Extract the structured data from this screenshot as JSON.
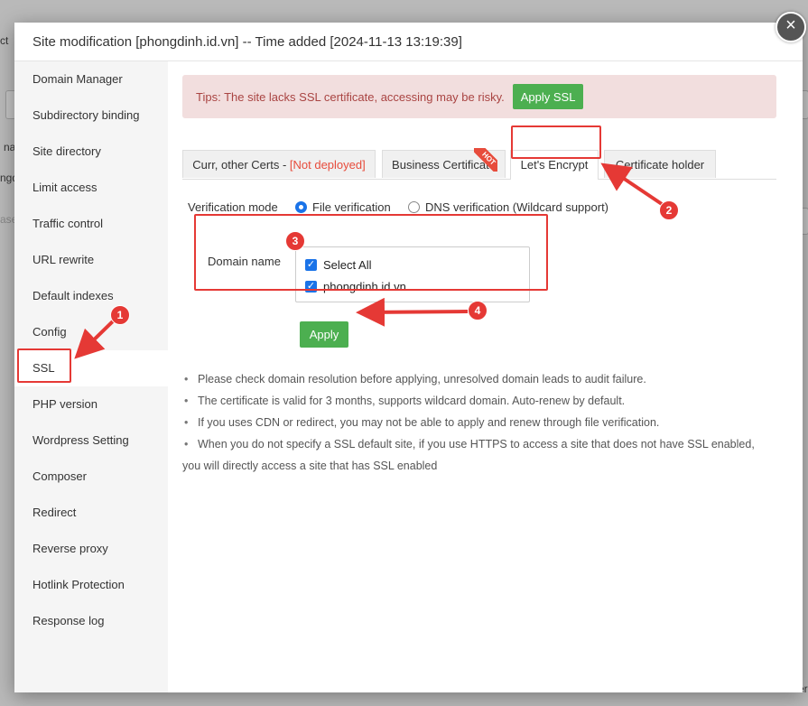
{
  "background": {
    "fragments": [
      "ct",
      "na",
      "ngd",
      "ase",
      "mer"
    ]
  },
  "modal": {
    "title": "Site modification [phongdinh.id.vn] -- Time added [2024-11-13 13:19:39]",
    "close_symbol": "×"
  },
  "sidebar": {
    "items": [
      {
        "label": "Domain Manager"
      },
      {
        "label": "Subdirectory binding"
      },
      {
        "label": "Site directory"
      },
      {
        "label": "Limit access"
      },
      {
        "label": "Traffic control"
      },
      {
        "label": "URL rewrite"
      },
      {
        "label": "Default indexes"
      },
      {
        "label": "Config"
      },
      {
        "label": "SSL"
      },
      {
        "label": "PHP version"
      },
      {
        "label": "Wordpress Setting"
      },
      {
        "label": "Composer"
      },
      {
        "label": "Redirect"
      },
      {
        "label": "Reverse proxy"
      },
      {
        "label": "Hotlink Protection"
      },
      {
        "label": "Response log"
      }
    ],
    "active": "SSL"
  },
  "tips": {
    "text": "Tips: The site lacks SSL certificate, accessing may be risky.",
    "button": "Apply SSL"
  },
  "tabs": {
    "curr_label": "Curr, other Certs - ",
    "curr_status": "[Not deployed]",
    "business": "Business Certificate",
    "hot_badge": "HOT",
    "letsencrypt": "Let's Encrypt",
    "holder": "Certificate holder",
    "active": "Let's Encrypt"
  },
  "verification": {
    "label": "Verification mode",
    "options": [
      "File verification",
      "DNS verification (Wildcard support)"
    ],
    "selected": "File verification"
  },
  "domain": {
    "label": "Domain name",
    "select_all": "Select All",
    "domains": [
      "phongdinh.id.vn"
    ],
    "checked": true
  },
  "apply_button": "Apply",
  "notes": [
    "Please check domain resolution before applying, unresolved domain leads to audit failure.",
    "The certificate is valid for 3 months, supports wildcard domain. Auto-renew by default.",
    "If you uses CDN or redirect, you may not be able to apply and renew through file verification.",
    "When you do not specify a SSL default site, if you use HTTPS to access a site that does not have SSL enabled,"
  ],
  "notes_continuation": "you will directly access a site that has SSL enabled",
  "annotations": [
    "1",
    "2",
    "3",
    "4"
  ],
  "colors": {
    "accent_green": "#4caf50",
    "annotation_red": "#e53935",
    "tips_bg": "#f2dede",
    "tips_text": "#a94442",
    "checkbox_blue": "#1a73e8"
  }
}
